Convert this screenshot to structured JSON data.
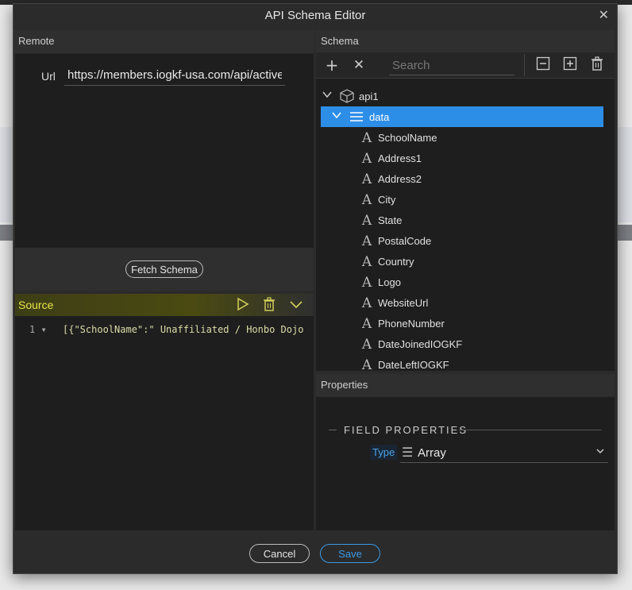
{
  "dialog": {
    "title": "API Schema Editor",
    "close_icon": "close-icon"
  },
  "remote": {
    "header": "Remote",
    "url_label": "Url",
    "url_value": "https://members.iogkf-usa.com/api/active",
    "fetch_label": "Fetch Schema"
  },
  "source": {
    "header": "Source",
    "line_number": "1 ▾",
    "code": "[{\"SchoolName\":\" Unaffiliated / Honbo Dojo"
  },
  "schema": {
    "header": "Schema",
    "search_placeholder": "Search",
    "root": "api1",
    "selected": "data",
    "fields": [
      "SchoolName",
      "Address1",
      "Address2",
      "City",
      "State",
      "PostalCode",
      "Country",
      "Logo",
      "WebsiteUrl",
      "PhoneNumber",
      "DateJoinedIOGKF",
      "DateLeftIOGKF"
    ]
  },
  "properties": {
    "header": "Properties",
    "section_title": "FIELD PROPERTIES",
    "type_label": "Type",
    "type_value": "Array"
  },
  "footer": {
    "cancel_label": "Cancel",
    "save_label": "Save"
  },
  "colors": {
    "accent": "#2d8ee8",
    "source_header": "#e8e64a"
  }
}
